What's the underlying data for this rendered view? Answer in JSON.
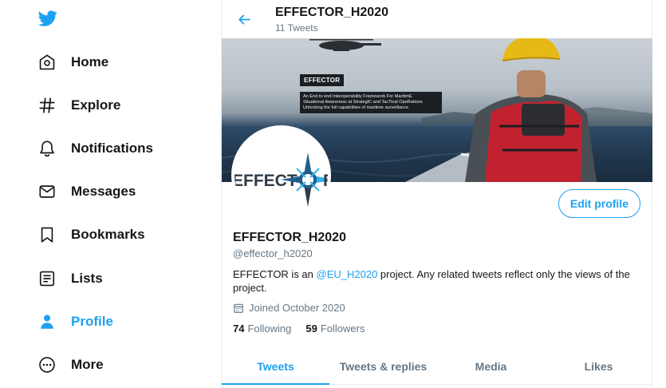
{
  "nav": {
    "items": [
      {
        "label": "Home",
        "icon": "home-icon"
      },
      {
        "label": "Explore",
        "icon": "hashtag-icon"
      },
      {
        "label": "Notifications",
        "icon": "bell-icon"
      },
      {
        "label": "Messages",
        "icon": "envelope-icon"
      },
      {
        "label": "Bookmarks",
        "icon": "bookmark-icon"
      },
      {
        "label": "Lists",
        "icon": "list-icon"
      },
      {
        "label": "Profile",
        "icon": "person-icon",
        "active": true
      },
      {
        "label": "More",
        "icon": "more-icon"
      }
    ]
  },
  "header": {
    "title": "EFFECTOR_H2020",
    "subtitle": "11 Tweets"
  },
  "banner": {
    "brand": "EFFECTOR",
    "tagline_1": "An End to end Interoperability Framework For MaritimE",
    "tagline_2": "Situational Awareness at StrategiC and TacTical OpeRations",
    "tagline_3": "Unlocking the full capabilities of maritime surveillance"
  },
  "avatar": {
    "text_left": "EFFECT",
    "text_right": "R"
  },
  "profile": {
    "name": "EFFECTOR_H2020",
    "handle": "@effector_h2020",
    "bio_before": "EFFECTOR is an ",
    "bio_mention": "@EU_H2020",
    "bio_after": " project. Any related tweets reflect only the views of the project.",
    "joined": "Joined October 2020",
    "following_count": "74",
    "following_label": "Following",
    "followers_count": "59",
    "followers_label": "Followers",
    "edit_label": "Edit profile"
  },
  "tabs": [
    {
      "label": "Tweets",
      "active": true
    },
    {
      "label": "Tweets & replies"
    },
    {
      "label": "Media"
    },
    {
      "label": "Likes"
    }
  ],
  "colors": {
    "accent": "#1da1f2",
    "text": "#14171a",
    "muted": "#657786"
  }
}
